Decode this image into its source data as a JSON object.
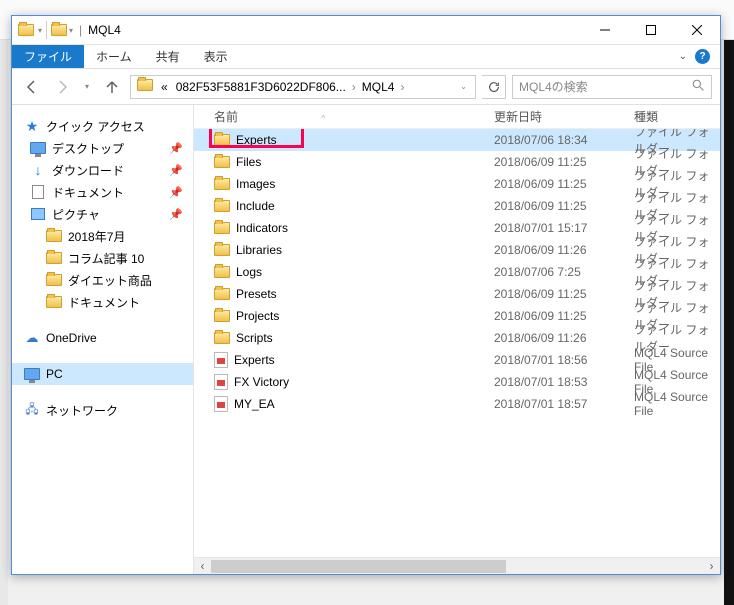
{
  "title": "MQL4",
  "tabs": {
    "file": "ファイル",
    "home": "ホーム",
    "share": "共有",
    "view": "表示"
  },
  "breadcrumb": {
    "sep0": "«",
    "seg1": "082F53F5881F3D6022DF806...",
    "seg2": "MQL4"
  },
  "search_placeholder": "MQL4の検索",
  "columns": {
    "name": "名前",
    "date": "更新日時",
    "type": "種類"
  },
  "type_folder": "ファイル フォルダー",
  "type_mql4": "MQL4 Source File",
  "nav": {
    "quick": "クイック アクセス",
    "desktop": "デスクトップ",
    "downloads": "ダウンロード",
    "documents": "ドキュメント",
    "pictures": "ピクチャ",
    "f1": "2018年7月",
    "f2": "コラム記事 10",
    "f3": "ダイエット商品",
    "f4": "ドキュメント",
    "onedrive": "OneDrive",
    "pc": "PC",
    "network": "ネットワーク"
  },
  "files": [
    {
      "name": "Experts",
      "date": "2018/07/06 18:34",
      "type": "folder",
      "selected": true,
      "highlight": true
    },
    {
      "name": "Files",
      "date": "2018/06/09 11:25",
      "type": "folder"
    },
    {
      "name": "Images",
      "date": "2018/06/09 11:25",
      "type": "folder"
    },
    {
      "name": "Include",
      "date": "2018/06/09 11:25",
      "type": "folder"
    },
    {
      "name": "Indicators",
      "date": "2018/07/01 15:17",
      "type": "folder"
    },
    {
      "name": "Libraries",
      "date": "2018/06/09 11:26",
      "type": "folder"
    },
    {
      "name": "Logs",
      "date": "2018/07/06 7:25",
      "type": "folder"
    },
    {
      "name": "Presets",
      "date": "2018/06/09 11:25",
      "type": "folder"
    },
    {
      "name": "Projects",
      "date": "2018/06/09 11:25",
      "type": "folder"
    },
    {
      "name": "Scripts",
      "date": "2018/06/09 11:26",
      "type": "folder"
    },
    {
      "name": "Experts",
      "date": "2018/07/01 18:56",
      "type": "mql4"
    },
    {
      "name": "FX Victory",
      "date": "2018/07/01 18:53",
      "type": "mql4"
    },
    {
      "name": "MY_EA",
      "date": "2018/07/01 18:57",
      "type": "mql4"
    }
  ]
}
